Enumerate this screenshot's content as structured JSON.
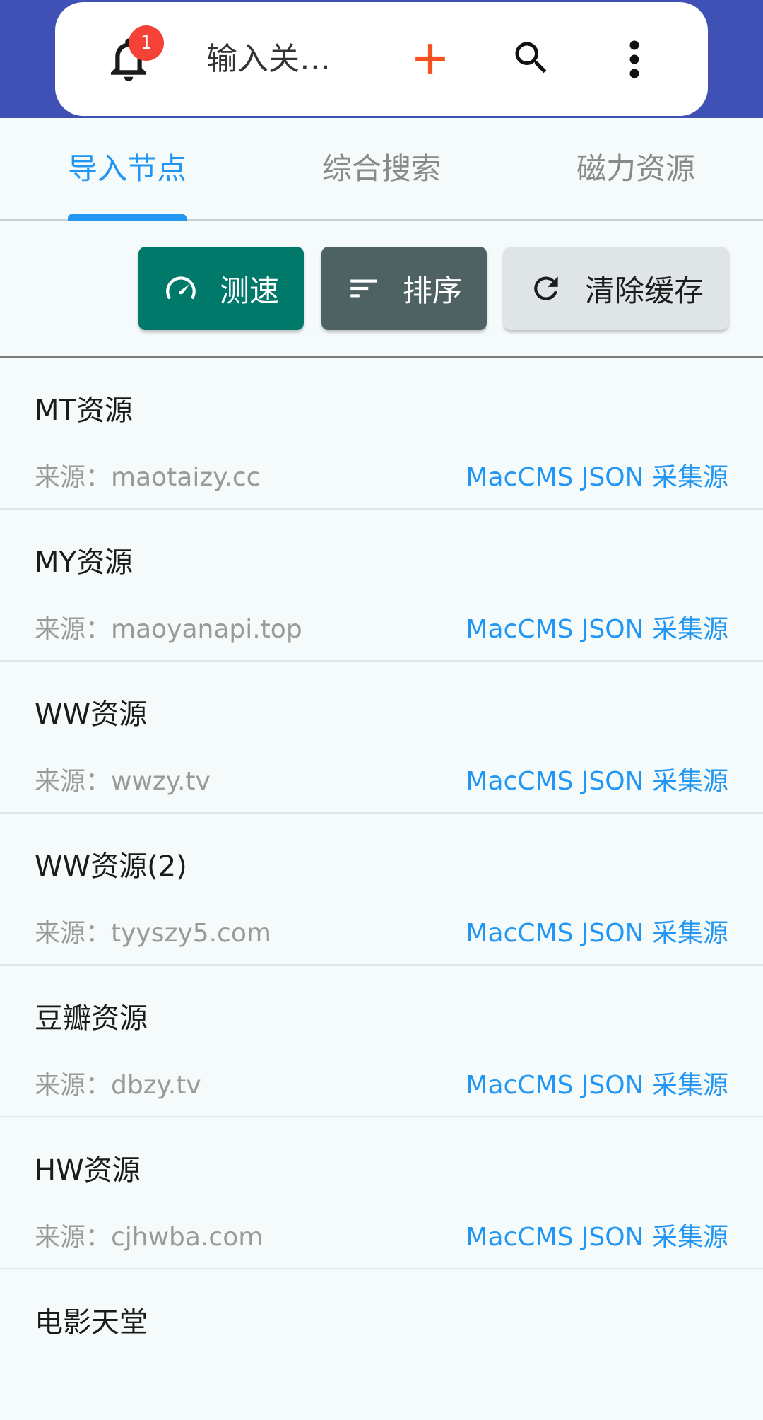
{
  "header": {
    "notification_count": "1",
    "search_placeholder": "输入关…"
  },
  "tabs": [
    {
      "label": "导入节点",
      "active": true
    },
    {
      "label": "综合搜索",
      "active": false
    },
    {
      "label": "磁力资源",
      "active": false
    }
  ],
  "actions": {
    "speed_label": "测速",
    "sort_label": "排序",
    "clear_label": "清除缓存"
  },
  "sources": [
    {
      "name": "MT资源",
      "source": "来源：maotaizy.cc",
      "type": "MacCMS JSON 采集源"
    },
    {
      "name": "MY资源",
      "source": "来源：maoyanapi.top",
      "type": "MacCMS JSON 采集源"
    },
    {
      "name": "WW资源",
      "source": "来源：wwzy.tv",
      "type": "MacCMS JSON 采集源"
    },
    {
      "name": "WW资源(2)",
      "source": "来源：tyyszy5.com",
      "type": "MacCMS JSON 采集源"
    },
    {
      "name": "豆瓣资源",
      "source": "来源：dbzy.tv",
      "type": "MacCMS JSON 采集源"
    },
    {
      "name": "HW资源",
      "source": "来源：cjhwba.com",
      "type": "MacCMS JSON 采集源"
    },
    {
      "name": "电影天堂",
      "source": "",
      "type": ""
    }
  ],
  "colors": {
    "appbar": "#3f51b5",
    "accent": "#2196f3",
    "speed_button": "#00796b",
    "sort_button": "#4e6163",
    "add_icon": "#f4511e",
    "badge": "#f44336"
  }
}
